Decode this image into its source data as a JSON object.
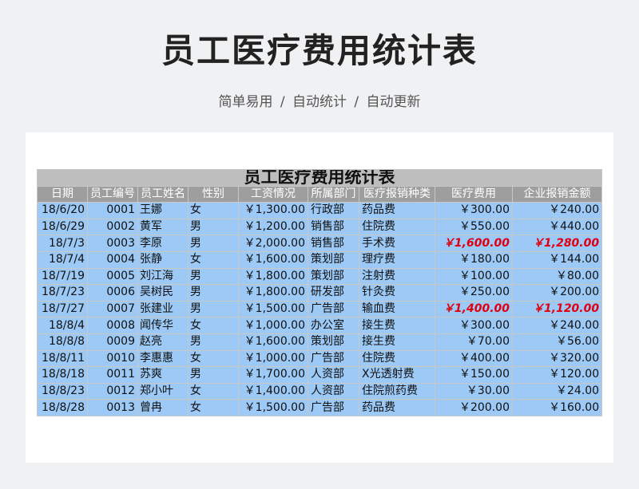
{
  "page": {
    "title": "员工医疗费用统计表",
    "subtitle": "简单易用 / 自动统计 / 自动更新"
  },
  "table": {
    "title": "员工医疗费用统计表",
    "headers": [
      "日期",
      "员工编号",
      "员工姓名",
      "性别",
      "工资情况",
      "所属部门",
      "医疗报销种类",
      "医疗费用",
      "企业报销金额"
    ],
    "rows": [
      [
        "18/6/20",
        "0001",
        "王娜",
        "女",
        "￥1,300.00",
        "行政部",
        "药品费",
        "￥300.00",
        "￥240.00"
      ],
      [
        "18/6/29",
        "0002",
        "黄军",
        "男",
        "￥1,200.00",
        "销售部",
        "住院费",
        "￥550.00",
        "￥440.00"
      ],
      [
        "18/7/3",
        "0003",
        "李原",
        "男",
        "￥2,000.00",
        "销售部",
        "手术费",
        "￥1,600.00",
        "￥1,280.00"
      ],
      [
        "18/7/4",
        "0004",
        "张静",
        "女",
        "￥1,600.00",
        "策划部",
        "理疗费",
        "￥180.00",
        "￥144.00"
      ],
      [
        "18/7/19",
        "0005",
        "刘江海",
        "男",
        "￥1,800.00",
        "策划部",
        "注射费",
        "￥100.00",
        "￥80.00"
      ],
      [
        "18/7/23",
        "0006",
        "吴树民",
        "男",
        "￥1,800.00",
        "研发部",
        "针灸费",
        "￥250.00",
        "￥200.00"
      ],
      [
        "18/7/27",
        "0007",
        "张建业",
        "男",
        "￥1,500.00",
        "广告部",
        "输血费",
        "￥1,400.00",
        "￥1,120.00"
      ],
      [
        "18/8/4",
        "0008",
        "闻传华",
        "女",
        "￥1,000.00",
        "办公室",
        "接生费",
        "￥300.00",
        "￥240.00"
      ],
      [
        "18/8/8",
        "0009",
        "赵亮",
        "男",
        "￥1,600.00",
        "策划部",
        "接生费",
        "￥70.00",
        "￥56.00"
      ],
      [
        "18/8/11",
        "0010",
        "李惠惠",
        "女",
        "￥1,000.00",
        "广告部",
        "住院费",
        "￥400.00",
        "￥320.00"
      ],
      [
        "18/8/18",
        "0011",
        "苏爽",
        "男",
        "￥1,700.00",
        "人资部",
        "X光透射费",
        "￥150.00",
        "￥120.00"
      ],
      [
        "18/8/23",
        "0012",
        "郑小叶",
        "女",
        "￥1,400.00",
        "人资部",
        "住院煎药费",
        "￥30.00",
        "￥24.00"
      ],
      [
        "18/8/28",
        "0013",
        "曾冉",
        "女",
        "￥1,500.00",
        "广告部",
        "药品费",
        "￥200.00",
        "￥160.00"
      ]
    ],
    "highlight_rows": [
      2,
      6
    ],
    "colors": {
      "title_bg": "#bdbdbd",
      "header_bg": "#9e9e9e",
      "cell_bg": "#9cc9f5",
      "highlight_text": "#e0000f"
    }
  }
}
